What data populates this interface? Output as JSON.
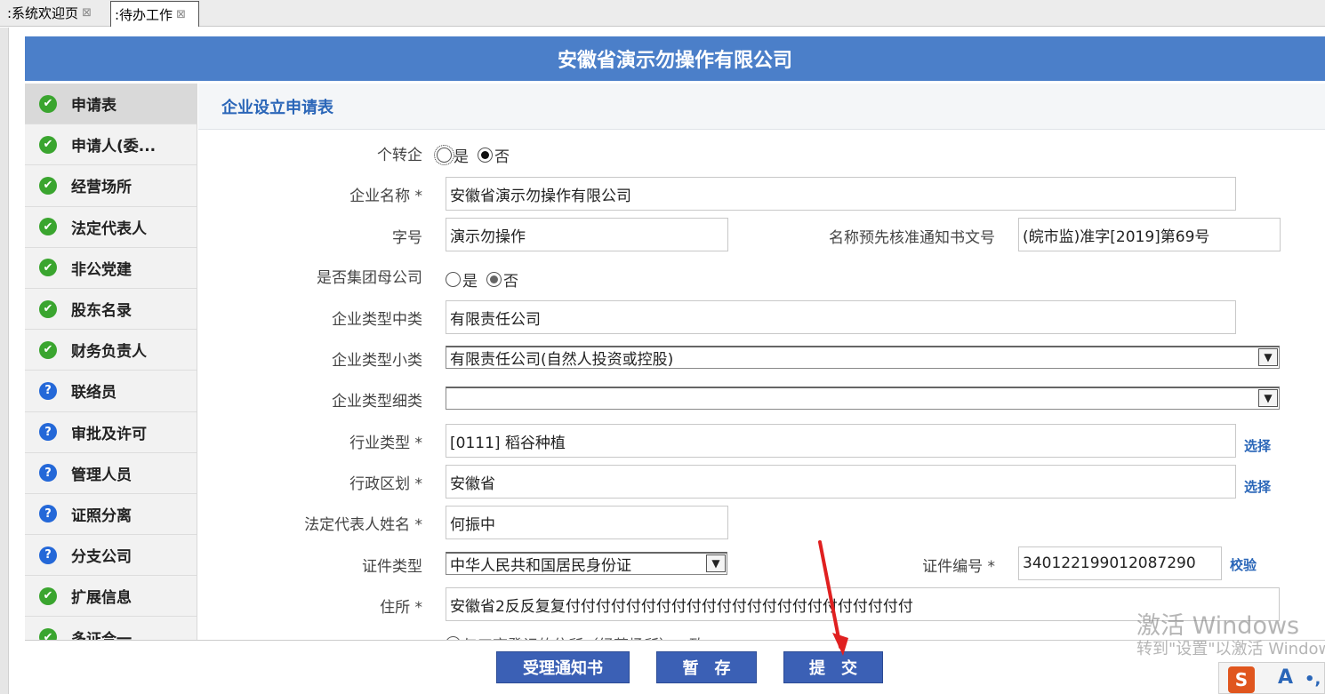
{
  "tabs": [
    {
      "label": ":系统欢迎页",
      "close": "⊠"
    },
    {
      "label": ":待办工作",
      "close": "⊠"
    }
  ],
  "banner": {
    "title": "安徽省演示勿操作有限公司"
  },
  "sidebar": {
    "items": [
      {
        "label": "申请表",
        "status": "ok"
      },
      {
        "label": "申请人(委...",
        "status": "ok"
      },
      {
        "label": "经营场所",
        "status": "ok"
      },
      {
        "label": "法定代表人",
        "status": "ok"
      },
      {
        "label": "非公党建",
        "status": "ok"
      },
      {
        "label": "股东名录",
        "status": "ok"
      },
      {
        "label": "财务负责人",
        "status": "ok"
      },
      {
        "label": "联络员",
        "status": "question"
      },
      {
        "label": "审批及许可",
        "status": "question"
      },
      {
        "label": "管理人员",
        "status": "question"
      },
      {
        "label": "证照分离",
        "status": "question"
      },
      {
        "label": "分支公司",
        "status": "question"
      },
      {
        "label": "扩展信息",
        "status": "ok"
      },
      {
        "label": "多证合一",
        "status": "ok"
      }
    ]
  },
  "form": {
    "section_title": "企业设立申请表",
    "individual_to_enterprise": {
      "label": "个转企",
      "opt_yes": "是",
      "opt_no": "否",
      "selected": "no"
    },
    "company_name": {
      "label": "企业名称",
      "required": "*",
      "value": "安徽省演示勿操作有限公司"
    },
    "trade_name": {
      "label": "字号",
      "value": "演示勿操作"
    },
    "notice_no": {
      "label": "名称预先核准通知书文号",
      "value": "(皖市监)准字[2019]第69号"
    },
    "group_parent": {
      "label": "是否集团母公司",
      "opt_yes": "是",
      "opt_no": "否",
      "selected": "no"
    },
    "type_mid": {
      "label": "企业类型中类",
      "value": "有限责任公司"
    },
    "type_small": {
      "label": "企业类型小类",
      "value": "有限责任公司(自然人投资或控股)"
    },
    "type_detail": {
      "label": "企业类型细类",
      "value": ""
    },
    "industry": {
      "label": "行业类型",
      "required": "*",
      "value": "[0111] 稻谷种植",
      "action": "选择"
    },
    "region": {
      "label": "行政区划",
      "required": "*",
      "value": "安徽省",
      "action": "选择"
    },
    "legal_rep": {
      "label": "法定代表人姓名",
      "required": "*",
      "value": "何振中"
    },
    "id_type": {
      "label": "证件类型",
      "value": "中华人民共和国居民身份证"
    },
    "id_no": {
      "label": "证件编号",
      "required": "*",
      "value": "340122199012087290",
      "action": "校验"
    },
    "address": {
      "label": "住所",
      "required": "*",
      "value": "安徽省2反反复复付付付付付付付付付付付付付付付付付付付付付付付"
    },
    "address_note": "与工商登记的住所（经营场所）一致"
  },
  "buttons": {
    "notice": "受理通知书",
    "save": "暂　存",
    "submit": "提　交"
  },
  "watermark": {
    "line1": "激活 Windows",
    "line2": "转到\"设置\"以激活 Windows。"
  },
  "ime": {
    "logo": "S",
    "mode": "A",
    "punct": "•,"
  }
}
